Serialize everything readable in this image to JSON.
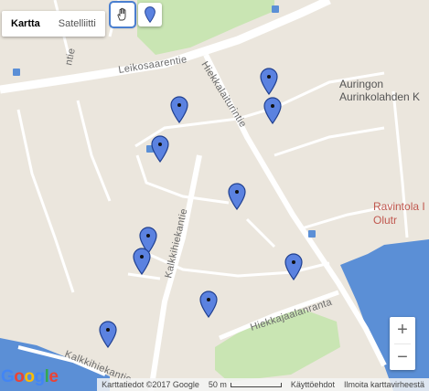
{
  "map_type": {
    "map_label": "Kartta",
    "satellite_label": "Satelliitti"
  },
  "streets": [
    {
      "name": "Leikosaarentie"
    },
    {
      "name": "Hiekkalaiturintie"
    },
    {
      "name": "Kalkkihiekantie"
    },
    {
      "name": "Hiekkajaalanranta"
    },
    {
      "name": "Kalkkihiekantie"
    },
    {
      "name": "ntie"
    }
  ],
  "pois": [
    {
      "name": "Auringon"
    },
    {
      "name": "Aurinkolahden K"
    },
    {
      "name": "Ravintola I"
    },
    {
      "name": "Olutr"
    }
  ],
  "markers": [
    {
      "name": "marker"
    },
    {
      "name": "marker"
    },
    {
      "name": "marker"
    },
    {
      "name": "marker"
    },
    {
      "name": "marker"
    },
    {
      "name": "marker"
    },
    {
      "name": "marker"
    },
    {
      "name": "marker"
    },
    {
      "name": "marker"
    },
    {
      "name": "marker"
    },
    {
      "name": "marker"
    }
  ],
  "controls": {
    "zoom_in": "+",
    "zoom_out": "−"
  },
  "footer": {
    "data": "Karttatiedot ©2017 Google",
    "scale": "50 m",
    "terms": "Käyttöehdot",
    "report": "Ilmoita karttavirheestä"
  },
  "logo": "Google",
  "colors": {
    "land": "#ebe6dd",
    "water": "#5b8fd6",
    "park": "#c9e5b3",
    "road": "#ffffff",
    "marker": "#5b82e0",
    "poi_red": "#c0584f"
  }
}
